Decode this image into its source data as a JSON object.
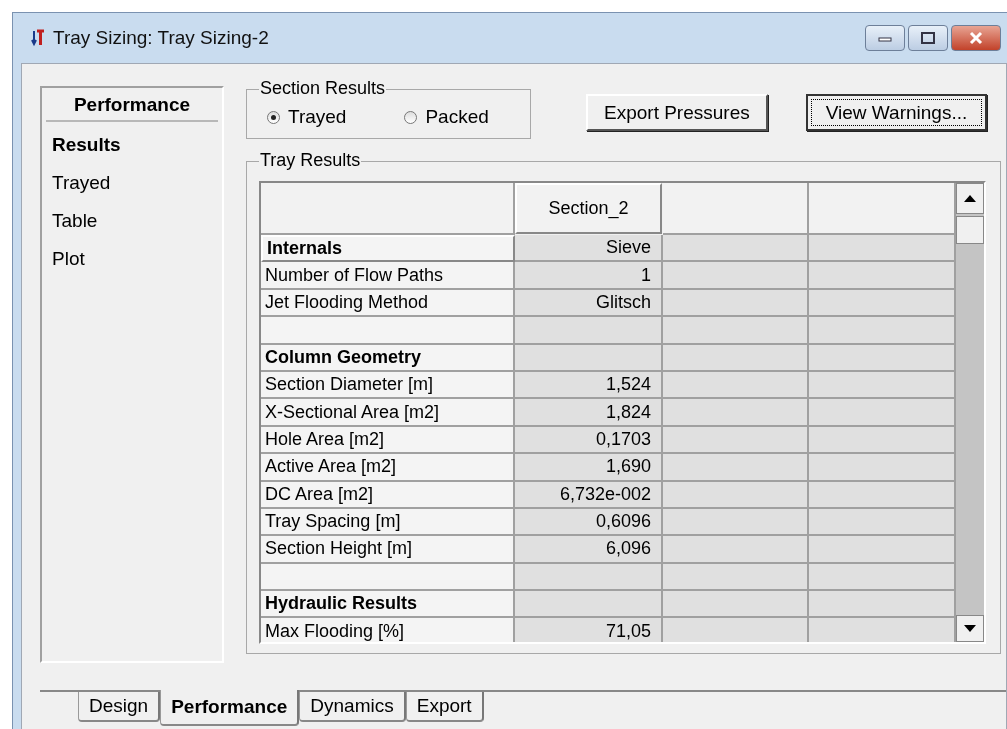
{
  "window": {
    "title": "Tray Sizing: Tray Sizing-2"
  },
  "sidebar": {
    "title": "Performance",
    "items": [
      {
        "label": "Results",
        "selected": true
      },
      {
        "label": "Trayed",
        "selected": false
      },
      {
        "label": "Table",
        "selected": false
      },
      {
        "label": "Plot",
        "selected": false
      }
    ]
  },
  "section_results": {
    "title": "Section Results",
    "options": [
      {
        "label": "Trayed",
        "selected": true
      },
      {
        "label": "Packed",
        "selected": false
      }
    ]
  },
  "buttons": [
    {
      "label": "Export Pressures",
      "focused": false
    },
    {
      "label": "View Warnings...",
      "focused": true
    }
  ],
  "tray_results": {
    "title": "Tray Results",
    "columns": [
      "Section_2"
    ],
    "rows": [
      {
        "kind": "group",
        "label": "Internals",
        "value": "Sieve"
      },
      {
        "kind": "data",
        "label": "Number of Flow Paths",
        "value": "1"
      },
      {
        "kind": "data",
        "label": "Jet Flooding Method",
        "value": "Glitsch"
      },
      {
        "kind": "blank"
      },
      {
        "kind": "group",
        "label": "Column Geometry"
      },
      {
        "kind": "data",
        "label": "Section Diameter [m]",
        "value": "1,524"
      },
      {
        "kind": "data",
        "label": "X-Sectional Area [m2]",
        "value": "1,824"
      },
      {
        "kind": "data",
        "label": "Hole Area [m2]",
        "value": "0,1703"
      },
      {
        "kind": "data",
        "label": "Active Area [m2]",
        "value": "1,690"
      },
      {
        "kind": "data",
        "label": "DC Area [m2]",
        "value": "6,732e-002"
      },
      {
        "kind": "data",
        "label": "Tray Spacing [m]",
        "value": "0,6096"
      },
      {
        "kind": "data",
        "label": "Section Height [m]",
        "value": "6,096"
      },
      {
        "kind": "blank"
      },
      {
        "kind": "group",
        "label": "Hydraulic Results"
      },
      {
        "kind": "data",
        "label": "Max Flooding [%]",
        "value": "71,05"
      }
    ]
  },
  "tabs": [
    {
      "label": "Design",
      "selected": false
    },
    {
      "label": "Performance",
      "selected": true
    },
    {
      "label": "Dynamics",
      "selected": false
    },
    {
      "label": "Export",
      "selected": false
    }
  ]
}
